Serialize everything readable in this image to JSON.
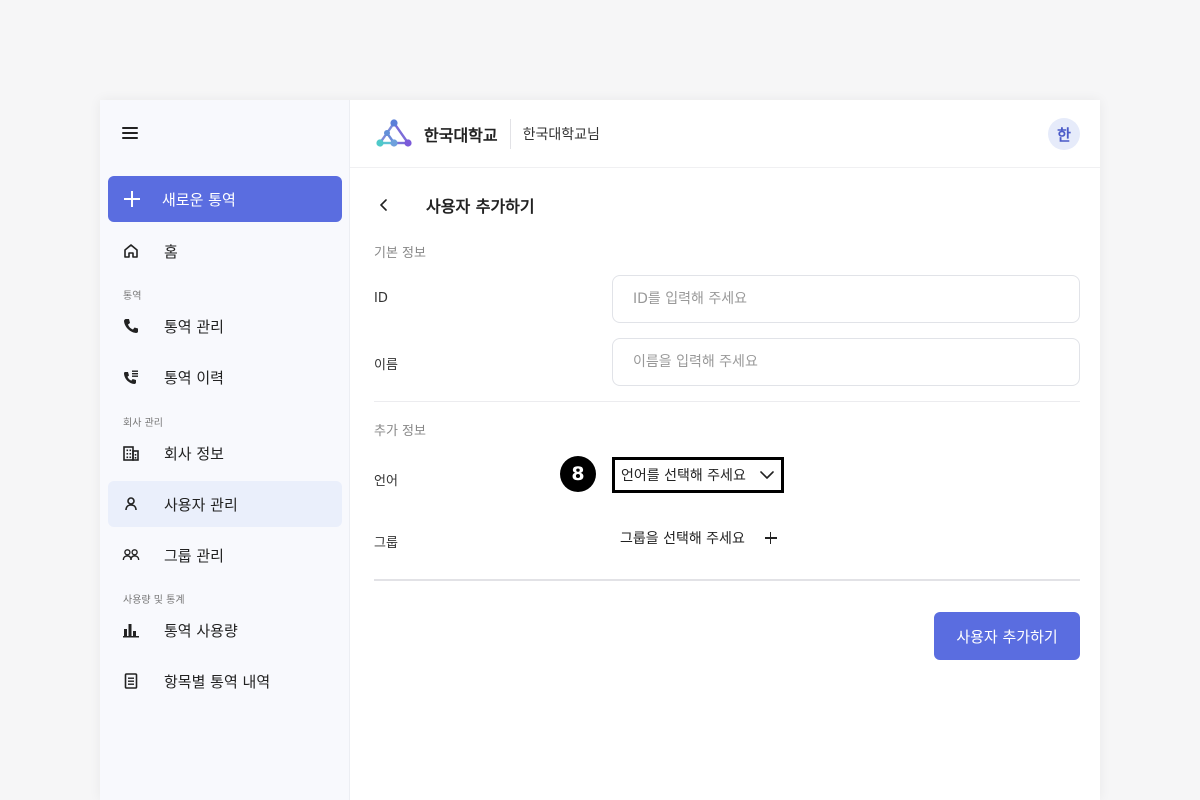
{
  "colors": {
    "accent": "#5a6de0",
    "active_bg": "#eaeffb",
    "sidebar_bg": "#f8f9fd"
  },
  "sidebar": {
    "new_button": {
      "label": "새로운 통역",
      "icon": "plus-icon"
    },
    "items": [
      {
        "label": "홈",
        "icon": "home-icon"
      },
      {
        "section": "통역"
      },
      {
        "label": "통역 관리",
        "icon": "phone-icon"
      },
      {
        "label": "통역 이력",
        "icon": "phone-history-icon"
      },
      {
        "section": "회사 관리"
      },
      {
        "label": "회사 정보",
        "icon": "building-icon"
      },
      {
        "label": "사용자 관리",
        "icon": "user-icon",
        "active": true
      },
      {
        "label": "그룹 관리",
        "icon": "users-icon"
      },
      {
        "section": "사용량 및 통계"
      },
      {
        "label": "통역 사용량",
        "icon": "bar-chart-icon"
      },
      {
        "label": "항목별 통역 내역",
        "icon": "document-icon"
      }
    ],
    "labels": {
      "home": "홈",
      "section_interp": "통역",
      "interp_manage": "통역 관리",
      "interp_history": "통역 이력",
      "section_company": "회사 관리",
      "company_info": "회사 정보",
      "user_manage": "사용자 관리",
      "group_manage": "그룹 관리",
      "section_usage": "사용량 및 통계",
      "interp_usage": "통역 사용량",
      "interp_detail": "항목별 통역 내역"
    }
  },
  "header": {
    "org_name": "한국대학교",
    "user_name": "한국대학교님",
    "avatar_initial": "한"
  },
  "page": {
    "title": "사용자 추가하기",
    "basic_section": "기본 정보",
    "id_label": "ID",
    "id_placeholder": "ID를 입력해 주세요",
    "name_label": "이름",
    "name_placeholder": "이름을 입력해 주세요",
    "extra_section": "추가 정보",
    "language_label": "언어",
    "language_select": "언어를 선택해 주세요",
    "group_label": "그룹",
    "group_select": "그룹을 선택해 주세요",
    "submit_label": "사용자 추가하기"
  },
  "annotation": {
    "step_number": "8"
  }
}
